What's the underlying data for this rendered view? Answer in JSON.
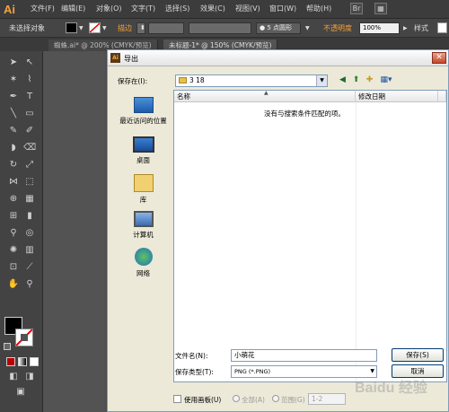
{
  "app": {
    "logo": "Ai"
  },
  "menubar": {
    "items": [
      "文件(F)",
      "编辑(E)",
      "对象(O)",
      "文字(T)",
      "选择(S)",
      "效果(C)",
      "视图(V)",
      "窗口(W)",
      "帮助(H)"
    ]
  },
  "controlbar": {
    "selection_label": "未选择对象",
    "stroke_label": "描边",
    "point_label": "5 点圆形",
    "opacity_label": "不透明度",
    "opacity_value": "100%",
    "style_label": "样式"
  },
  "tabs": [
    {
      "label": "蜘蛛.ai* @ 200% (CMYK/预览)"
    },
    {
      "label": "未标题-1* @ 150% (CMYK/预览)"
    }
  ],
  "dialog": {
    "title": "导出",
    "save_in_label": "保存在(I):",
    "save_in_value": "3 18",
    "places": [
      {
        "label": "最近访问的位置",
        "icon": "recent-places-icon"
      },
      {
        "label": "桌面",
        "icon": "desktop-icon"
      },
      {
        "label": "库",
        "icon": "libraries-icon"
      },
      {
        "label": "计算机",
        "icon": "computer-icon"
      },
      {
        "label": "网络",
        "icon": "network-icon"
      }
    ],
    "columns": {
      "name": "名称",
      "modified": "修改日期"
    },
    "empty_message": "没有与搜索条件匹配的项。",
    "filename_label": "文件名(N):",
    "filename_value": "小萌花",
    "filetype_label": "保存类型(T):",
    "filetype_value": "PNG (*.PNG)",
    "save_button": "保存(S)",
    "cancel_button": "取消",
    "use_artboards_label": "使用画板(U)",
    "all_label": "全部(A)",
    "range_label": "范围(G)",
    "range_value": "1-2"
  },
  "watermark": "Baidu 经验"
}
